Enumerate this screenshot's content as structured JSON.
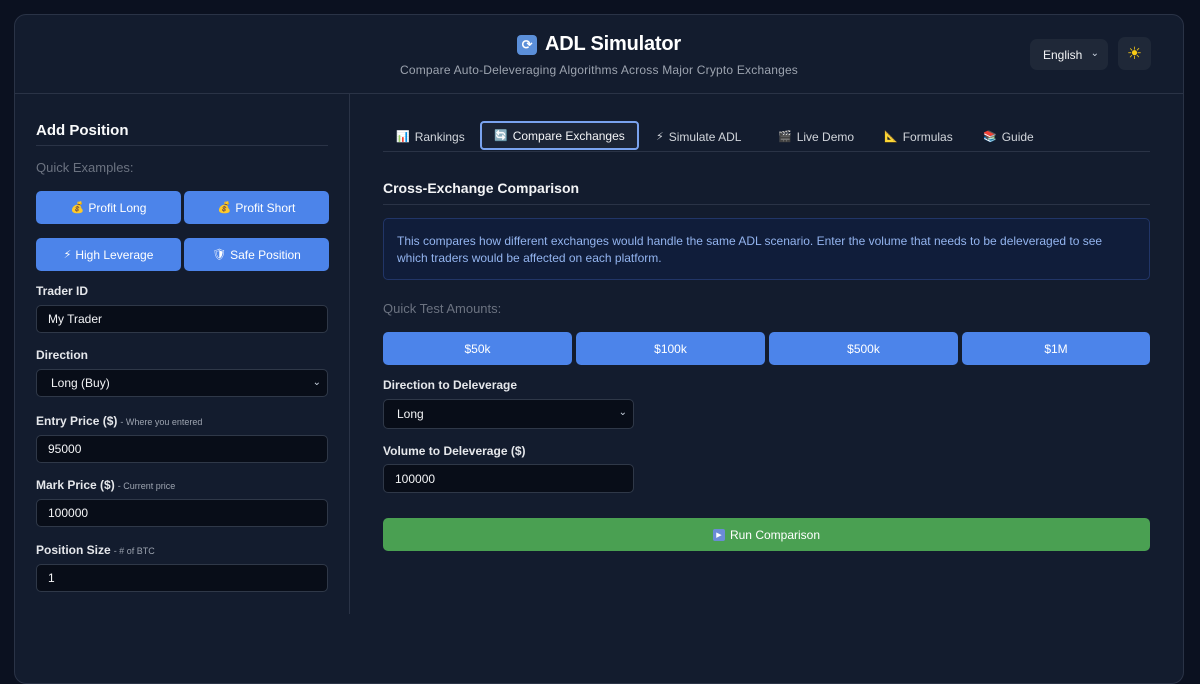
{
  "header": {
    "title": "ADL Simulator",
    "subtitle": "Compare Auto-Deleveraging Algorithms Across Major Crypto Exchanges",
    "language": "English",
    "theme_icon": "sun-icon"
  },
  "sidebar": {
    "heading": "Add Position",
    "quick_examples_label": "Quick Examples:",
    "quick_examples": [
      {
        "icon": "💰",
        "label": "Profit Long"
      },
      {
        "icon": "💰",
        "label": "Profit Short"
      },
      {
        "icon": "⚡",
        "label": "High Leverage"
      },
      {
        "icon": "🛡",
        "label": "Safe Position"
      }
    ],
    "fields": {
      "trader_id": {
        "label": "Trader ID",
        "value": "My Trader"
      },
      "direction": {
        "label": "Direction",
        "value": "Long (Buy)"
      },
      "entry_price": {
        "label": "Entry Price ($)",
        "hint": "- Where you entered",
        "value": "95000"
      },
      "mark_price": {
        "label": "Mark Price ($)",
        "hint": "- Current price",
        "value": "100000"
      },
      "position_size": {
        "label": "Position Size",
        "hint": "- # of BTC",
        "value": "1"
      }
    }
  },
  "tabs": [
    {
      "icon": "📊",
      "label": "Rankings"
    },
    {
      "icon": "🔄",
      "label": "Compare Exchanges",
      "active": true
    },
    {
      "icon": "⚡",
      "label": "Simulate ADL"
    },
    {
      "icon": "🎬",
      "label": "Live Demo"
    },
    {
      "icon": "📐",
      "label": "Formulas"
    },
    {
      "icon": "📚",
      "label": "Guide"
    }
  ],
  "main": {
    "section_title": "Cross-Exchange Comparison",
    "info_text": "This compares how different exchanges would handle the same ADL scenario. Enter the volume that needs to be deleveraged to see which traders would be affected on each platform.",
    "quick_test_label": "Quick Test Amounts:",
    "amounts": [
      "$50k",
      "$100k",
      "$500k",
      "$1M"
    ],
    "direction_label": "Direction to Deleverage",
    "direction_value": "Long",
    "volume_label": "Volume to Deleverage ($)",
    "volume_value": "100000",
    "run_label": "Run Comparison"
  },
  "colors": {
    "accent_blue": "#4c84ea",
    "run_green": "#4aa052",
    "background": "#131c2e"
  }
}
